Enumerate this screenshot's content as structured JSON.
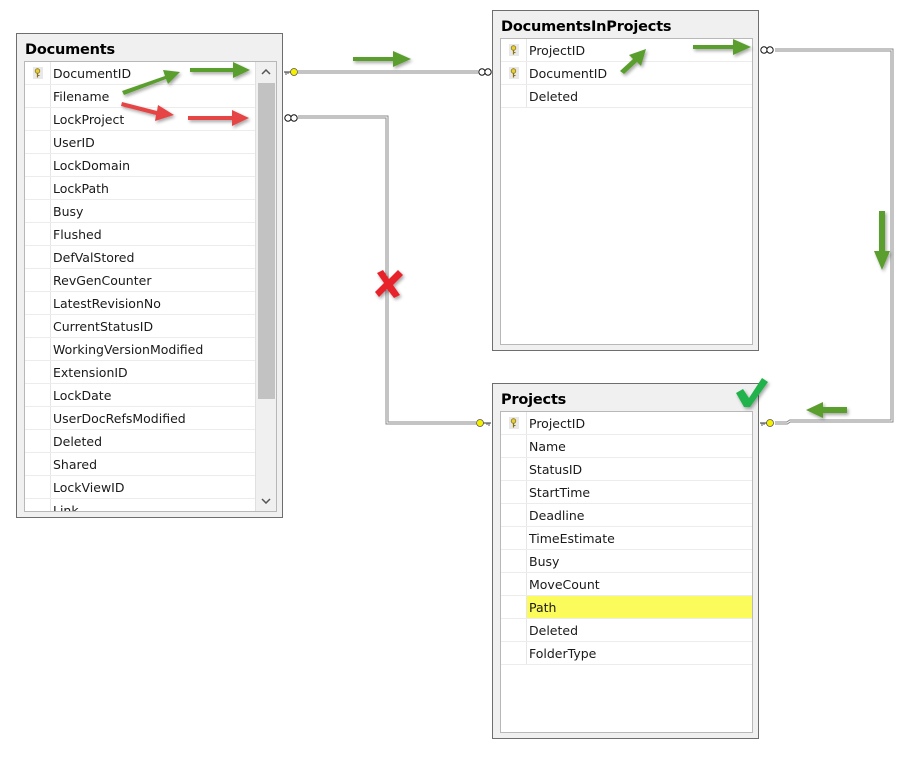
{
  "tables": {
    "documents": {
      "title": "Documents",
      "columns": [
        {
          "name": "DocumentID",
          "primary_key": true
        },
        {
          "name": "Filename"
        },
        {
          "name": "LockProject"
        },
        {
          "name": "UserID"
        },
        {
          "name": "LockDomain"
        },
        {
          "name": "LockPath"
        },
        {
          "name": "Busy"
        },
        {
          "name": "Flushed"
        },
        {
          "name": "DefValStored"
        },
        {
          "name": "RevGenCounter"
        },
        {
          "name": "LatestRevisionNo"
        },
        {
          "name": "CurrentStatusID"
        },
        {
          "name": "WorkingVersionModified"
        },
        {
          "name": "ExtensionID"
        },
        {
          "name": "LockDate"
        },
        {
          "name": "UserDocRefsModified"
        },
        {
          "name": "Deleted"
        },
        {
          "name": "Shared"
        },
        {
          "name": "LockViewID"
        },
        {
          "name": "Link"
        }
      ],
      "scroll_up_glyph": "˄",
      "scroll_down_glyph": "˅"
    },
    "documents_in_projects": {
      "title": "DocumentsInProjects",
      "columns": [
        {
          "name": "ProjectID",
          "primary_key": true
        },
        {
          "name": "DocumentID",
          "primary_key": true
        },
        {
          "name": "Deleted"
        }
      ]
    },
    "projects": {
      "title": "Projects",
      "columns": [
        {
          "name": "ProjectID",
          "primary_key": true
        },
        {
          "name": "Name"
        },
        {
          "name": "StatusID"
        },
        {
          "name": "StartTime"
        },
        {
          "name": "Deadline"
        },
        {
          "name": "TimeEstimate"
        },
        {
          "name": "Busy"
        },
        {
          "name": "MoveCount"
        },
        {
          "name": "Path",
          "highlighted": true
        },
        {
          "name": "Deleted"
        },
        {
          "name": "FolderType"
        }
      ]
    }
  },
  "relationships": [
    {
      "from": "Documents.DocumentID",
      "to": "DocumentsInProjects.DocumentID",
      "from_end": "key",
      "to_end": "infinity",
      "status": "valid"
    },
    {
      "from": "Documents.LockProject",
      "to": "Projects.ProjectID",
      "from_end": "infinity",
      "to_end": "key",
      "status": "invalid"
    },
    {
      "from": "DocumentsInProjects.ProjectID",
      "to": "Projects.ProjectID",
      "from_end": "infinity",
      "to_end": "key",
      "status": "valid"
    }
  ],
  "annotations": {
    "valid_color": "#5a9e2f",
    "invalid_color": "#e64545",
    "cross_mark": "invalid-relationship",
    "check_mark": "valid-relationship",
    "highlight_color": "#fbfb5c"
  }
}
